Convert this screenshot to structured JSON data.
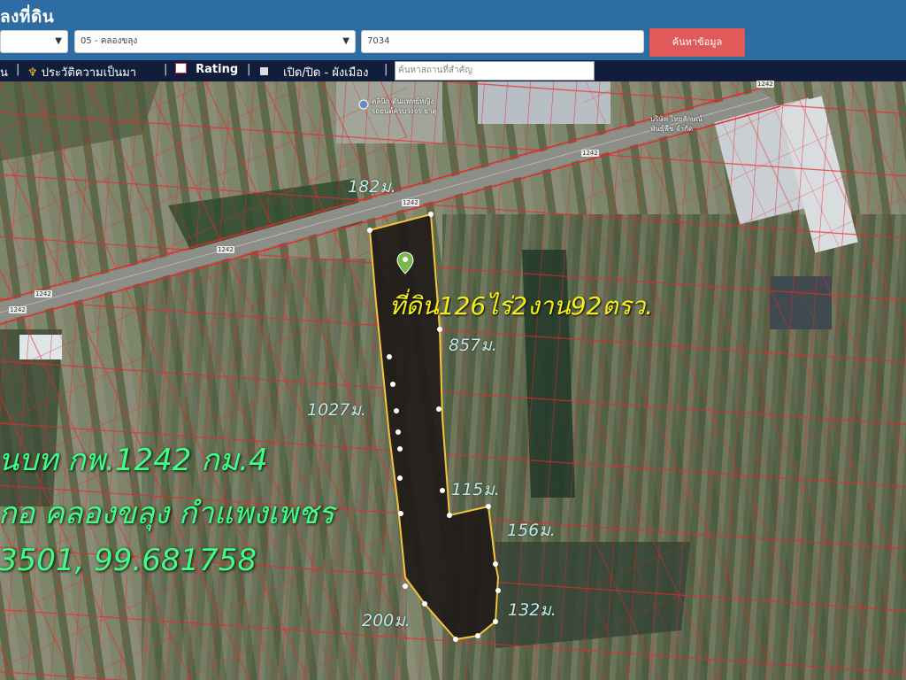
{
  "header": {
    "title": "ลงที่ดิน",
    "province_value": "",
    "district_value": "05 - คลองขลุง",
    "parcel_value": "7034",
    "search_button": "ค้นหาข้อมูล"
  },
  "toolbar": {
    "item1": "น",
    "item2": "ประวัติความเป็นมา",
    "item3": "Rating",
    "item4": "เปิด/ปิด - ผังเมือง",
    "search_placeholder": "ค้นหาสถานที่สำคัญ",
    "separator": "|"
  },
  "map": {
    "area_label": "ที่ดิน126ไร่2งาน92ตรว.",
    "distances": {
      "top": "182ม.",
      "east_upper": "857ม.",
      "west": "1027ม.",
      "step": "115ม.",
      "east_lower": "156ม.",
      "south_east": "132ม.",
      "south_west": "200ม."
    },
    "info_line1": "นบท กพ.1242 กม.4",
    "info_line2": "กอ คลองขลุง กำแพงเพชร",
    "info_line3": "3501, 99.681758",
    "road_numbers": [
      "1242",
      "1242",
      "1242",
      "1242",
      "1242",
      "1242"
    ],
    "poi_left": "คลินิก ตันแพทย์หญิง",
    "poi_left2": "รถยนต์ครบวงจร ธาตุ",
    "poi_right": "บริษัท ไทยลักษณ์",
    "poi_right2": "พันธุ์พืช จำกัด",
    "colors": {
      "parcel_lines": "#e8262b",
      "boundary": "#f3c33a",
      "header": "#2e6da4",
      "toolbar": "#111d3a",
      "search_button": "#e15a5a",
      "distance_text": "#bfe9e2",
      "area_text": "#f4ee16",
      "info_text": "#3dff84"
    },
    "icons": [
      "map-pin-icon",
      "history-icon",
      "rating-icon",
      "zoning-toggle-icon"
    ]
  }
}
